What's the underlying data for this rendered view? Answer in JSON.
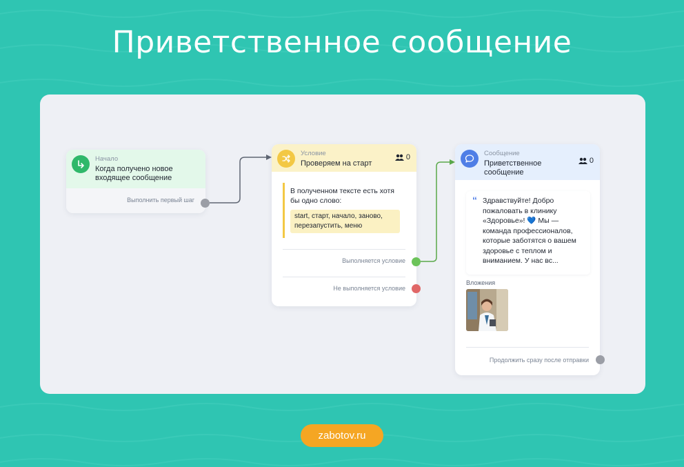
{
  "page": {
    "title": "Приветственное сообщение",
    "brand": "zabotov.ru"
  },
  "colors": {
    "background": "#2fc5b2",
    "start_accent": "#2fb86a",
    "condition_accent": "#f3c844",
    "message_accent": "#4f7ee6",
    "success_port": "#6cc35a",
    "fail_port": "#e06767",
    "neutral_port": "#9b9ea6",
    "brand_pill": "#f5a623"
  },
  "nodes": {
    "start": {
      "kind": "Начало",
      "title": "Когда получено новое входящее сообщение",
      "icon": "arrow-turn-right-icon",
      "outlet": "Выполнить первый шаг"
    },
    "condition": {
      "kind": "Условие",
      "title": "Проверяем на старт",
      "icon": "shuffle-icon",
      "counter": "0",
      "counter_icon": "users-icon",
      "rule_text": "В полученном тексте есть хотя бы одно слово:",
      "rule_values": "start, старт, начало, заново, перезапустить, меню",
      "outlet_true": "Выполняется условие",
      "outlet_false": "Не выполняется условие"
    },
    "message": {
      "kind": "Сообщение",
      "title": "Приветственное сообщение",
      "icon": "chat-bubble-icon",
      "counter": "0",
      "counter_icon": "users-icon",
      "text": "Здравствуйте! Добро пожаловать в клинику «Здоровье»! 💙 Мы — команда профессионалов, которые заботятся о вашем здоровье с теплом и вниманием. У нас вс...",
      "attachments_label": "Вложения",
      "attachment_image": "doctor-photo",
      "outlet": "Продолжить сразу после отправки"
    }
  }
}
